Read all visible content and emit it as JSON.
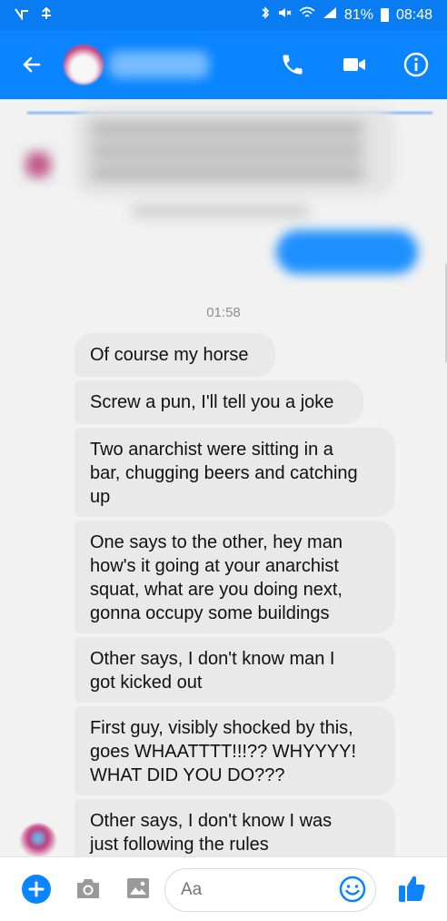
{
  "status_bar": {
    "left_icons": [
      "notification-icon-1",
      "notification-icon-2"
    ],
    "right_icons": [
      "bluetooth-icon",
      "mute-icon",
      "wifi-icon",
      "signal-icon"
    ],
    "battery": "81%",
    "time": "08:48"
  },
  "header": {
    "contact_name": "",
    "back_icon": "arrow-left-icon",
    "actions": [
      "phone-icon",
      "video-icon",
      "info-icon"
    ]
  },
  "conversation": {
    "timestamp": "01:58",
    "messages": [
      {
        "text": "Of course my horse"
      },
      {
        "text": "Screw a pun, I'll tell you a joke"
      },
      {
        "text": "Two anarchist were sitting in a\nbar, chugging beers and catching\nup"
      },
      {
        "text": "One says to the other, hey man\nhow's it going at your anarchist\nsquat, what are you doing next,\ngonna occupy some buildings"
      },
      {
        "text": "Other says, I don't know man I\ngot kicked out"
      },
      {
        "text": "First guy, visibly shocked by this,\ngoes WHAATTTT!!!?? WHYYYY!\nWHAT DID YOU DO???"
      },
      {
        "text": "Other says, I don't know I was\njust following the rules"
      }
    ]
  },
  "composer": {
    "placeholder": "Aa",
    "colors": {
      "accent": "#0a84ff"
    }
  }
}
